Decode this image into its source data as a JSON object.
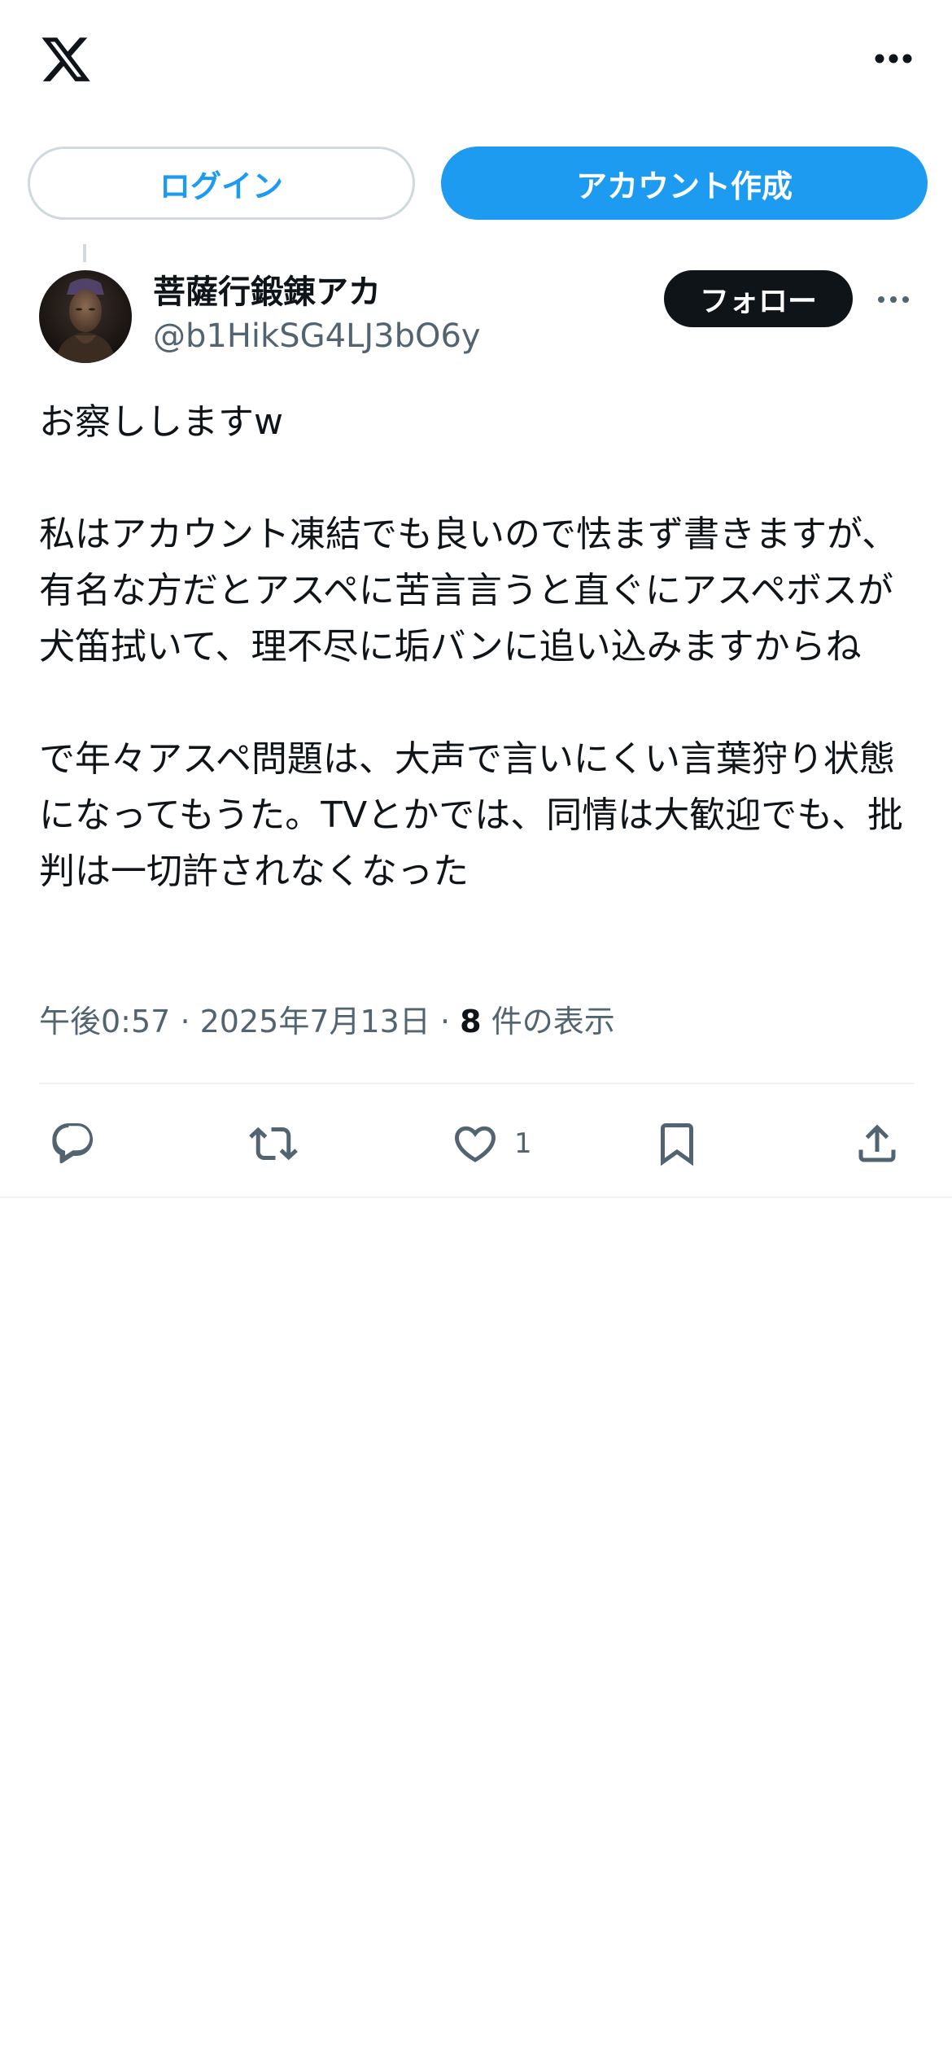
{
  "header": {
    "logo_icon": "x-logo-icon",
    "more_icon": "more-horizontal-icon"
  },
  "auth": {
    "login_label": "ログイン",
    "create_account_label": "アカウント作成",
    "accent_color": "#1d9bf0"
  },
  "post": {
    "author": {
      "display_name": "菩薩行鍛錬アカ",
      "handle": "@b1HikSG4LJ3bO6y",
      "avatar_icon": "avatar-buddha-statue-image"
    },
    "follow_label": "フォロー",
    "text": "お察ししますw\n\n私はアカウント凍結でも良いので怯まず書きますが、有名な方だとアスペに苦言言うと直ぐにアスペボスが犬笛拭いて、理不尽に垢バンに追い込みますからね\n\nで年々アスペ問題は、大声で言いにくい言葉狩り状態になってもうた。TVとかでは、同情は大歓迎でも、批判は一切許されなくなった",
    "time": "午後0:57",
    "date": "2025年7月13日",
    "separator": "·",
    "views_count": "8",
    "views_label": "件の表示"
  },
  "actions": {
    "reply_icon": "reply-icon",
    "repost_icon": "repost-icon",
    "like_icon": "heart-icon",
    "like_count": "1",
    "bookmark_icon": "bookmark-icon",
    "share_icon": "share-icon"
  }
}
